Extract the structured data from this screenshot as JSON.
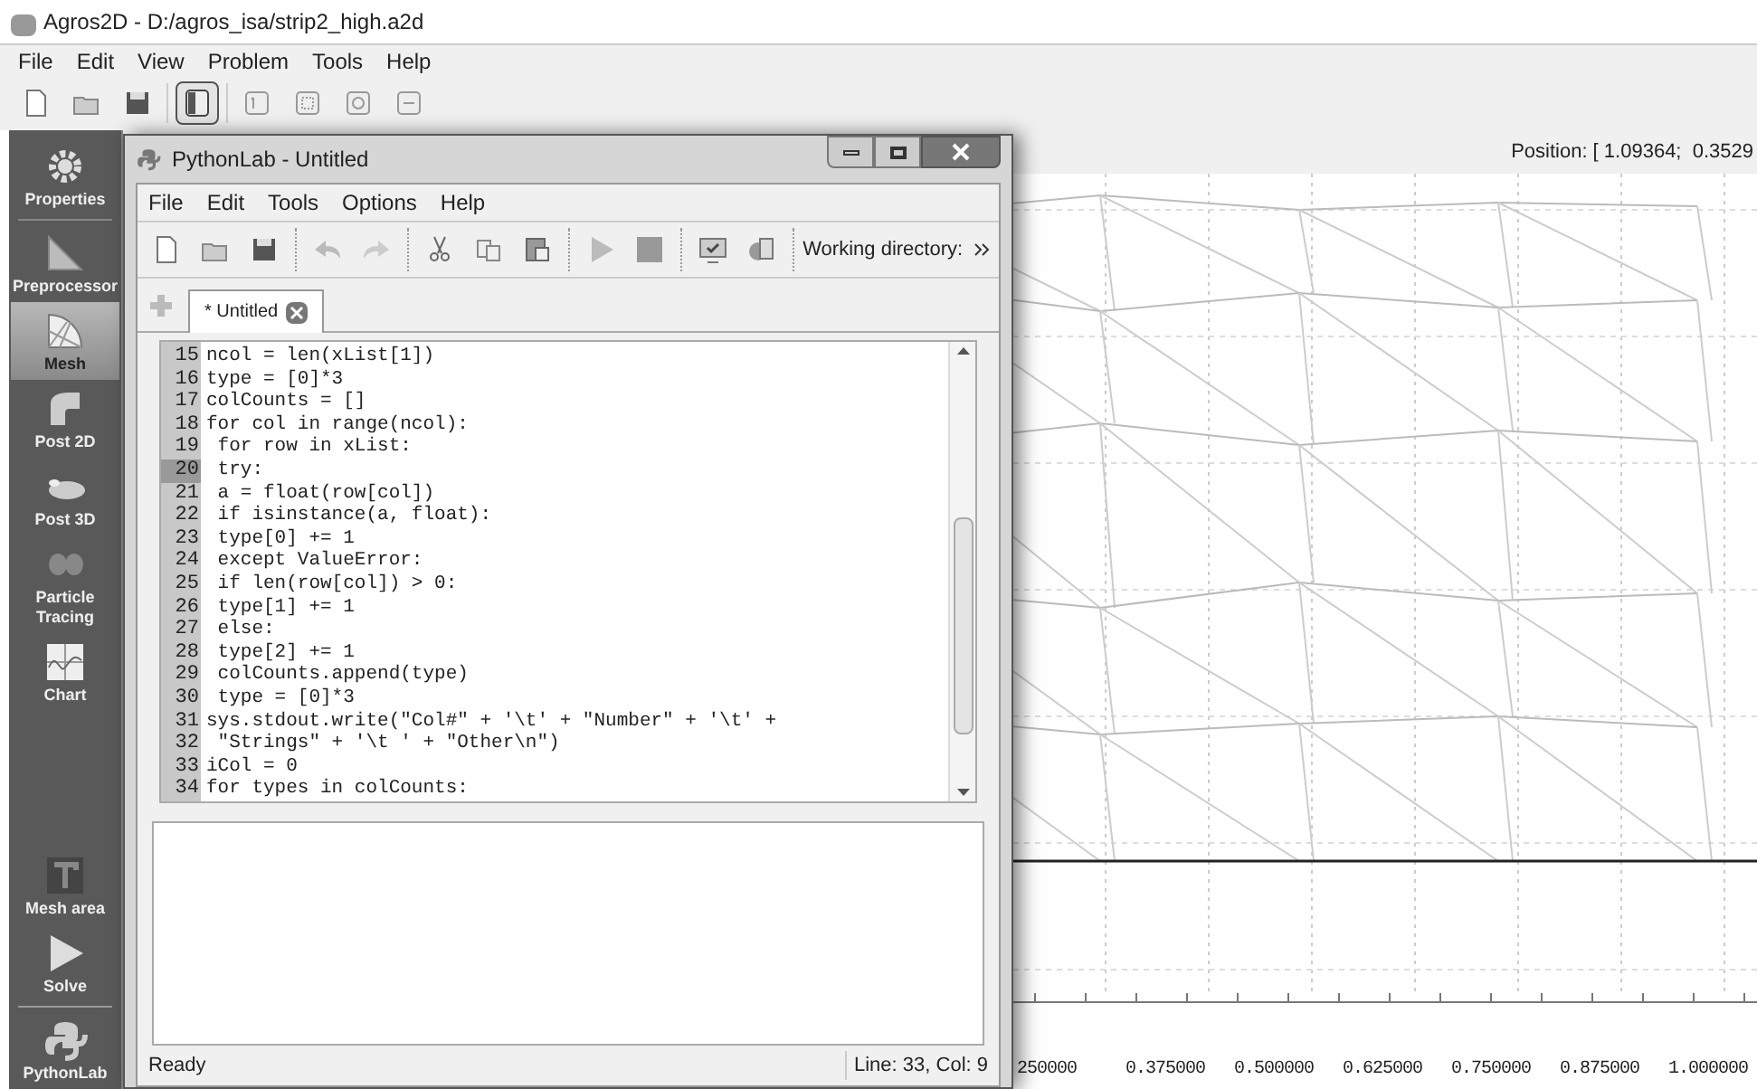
{
  "window": {
    "title": "Agros2D - D:/agros_isa/strip2_high.a2d"
  },
  "menu": [
    "File",
    "Edit",
    "View",
    "Problem",
    "Tools",
    "Help"
  ],
  "toolbar": [
    {
      "kind": "new",
      "selected": false
    },
    {
      "kind": "open",
      "selected": false
    },
    {
      "kind": "save",
      "selected": false
    },
    {
      "kind": "panel",
      "selected": true
    },
    {
      "kind": "zoom-best",
      "selected": false
    },
    {
      "kind": "zoom-region",
      "selected": false
    },
    {
      "kind": "zoom-in",
      "selected": false
    },
    {
      "kind": "zoom-out",
      "selected": false
    }
  ],
  "sidebar": {
    "items": [
      {
        "label": "Properties",
        "kind": "gear",
        "selected": false
      },
      {
        "label": "Preprocessor",
        "kind": "preprocessor",
        "selected": false
      },
      {
        "label": "Mesh",
        "kind": "mesh",
        "selected": true
      },
      {
        "label": "Post 2D",
        "kind": "post2d",
        "selected": false
      },
      {
        "label": "Post 3D",
        "kind": "post3d",
        "selected": false
      },
      {
        "label": "Particle Tracing",
        "kind": "particle",
        "selected": false
      },
      {
        "label": "Chart",
        "kind": "chart",
        "selected": false
      }
    ],
    "bottom_items": [
      {
        "label": "Mesh area",
        "kind": "mesharea",
        "selected": false
      },
      {
        "label": "Solve",
        "kind": "solve",
        "selected": false
      },
      {
        "label": "PythonLab",
        "kind": "python",
        "selected": false
      }
    ]
  },
  "canvas": {
    "position": "Position: [ 1.09364;  0.3529",
    "axis_labels": [
      "250000",
      "0.375000",
      "0.500000",
      "0.625000",
      "0.750000",
      "0.875000",
      "1.000000"
    ]
  },
  "python_lab": {
    "title": "PythonLab - Untitled",
    "menu": [
      "File",
      "Edit",
      "Tools",
      "Options",
      "Help"
    ],
    "toolbar": [
      {
        "kind": "new"
      },
      {
        "kind": "open"
      },
      {
        "kind": "save"
      },
      {
        "kind": "sep"
      },
      {
        "kind": "undo"
      },
      {
        "kind": "redo"
      },
      {
        "kind": "sep"
      },
      {
        "kind": "cut"
      },
      {
        "kind": "copy"
      },
      {
        "kind": "paste"
      },
      {
        "kind": "sep"
      },
      {
        "kind": "run"
      },
      {
        "kind": "stop"
      },
      {
        "kind": "sep"
      },
      {
        "kind": "check"
      },
      {
        "kind": "export"
      },
      {
        "kind": "sep"
      }
    ],
    "working_directory_label": "Working directory:",
    "tabs": [
      {
        "label": "* Untitled",
        "selected": true
      }
    ],
    "editor": {
      "lines": [
        {
          "number": "15",
          "text": "ncol = len(xList[1])",
          "current": false
        },
        {
          "number": "16",
          "text": "type = [0]*3",
          "current": false
        },
        {
          "number": "17",
          "text": "colCounts = []",
          "current": false
        },
        {
          "number": "18",
          "text": "for col in range(ncol):",
          "current": false
        },
        {
          "number": "19",
          "text": " for row in xList:",
          "current": false
        },
        {
          "number": "20",
          "text": " try:",
          "current": true
        },
        {
          "number": "21",
          "text": " a = float(row[col])",
          "current": false
        },
        {
          "number": "22",
          "text": " if isinstance(a, float):",
          "current": false
        },
        {
          "number": "23",
          "text": " type[0] += 1",
          "current": false
        },
        {
          "number": "24",
          "text": " except ValueError:",
          "current": false
        },
        {
          "number": "25",
          "text": " if len(row[col]) > 0:",
          "current": false
        },
        {
          "number": "26",
          "text": " type[1] += 1",
          "current": false
        },
        {
          "number": "27",
          "text": " else:",
          "current": false
        },
        {
          "number": "28",
          "text": " type[2] += 1",
          "current": false
        },
        {
          "number": "29",
          "text": " colCounts.append(type)",
          "current": false
        },
        {
          "number": "30",
          "text": " type = [0]*3",
          "current": false
        },
        {
          "number": "31",
          "text": "sys.stdout.write(\"Col#\" + '\\t' + \"Number\" + '\\t' +",
          "current": false
        },
        {
          "number": "32",
          "text": " \"Strings\" + '\\t ' + \"Other\\n\")",
          "current": false
        },
        {
          "number": "33",
          "text": "iCol = 0",
          "current": false
        },
        {
          "number": "34",
          "text": "for types in colCounts:",
          "current": false
        }
      ]
    },
    "status": {
      "message": "Ready",
      "cursor": "Line: 33, Col: 9"
    }
  }
}
